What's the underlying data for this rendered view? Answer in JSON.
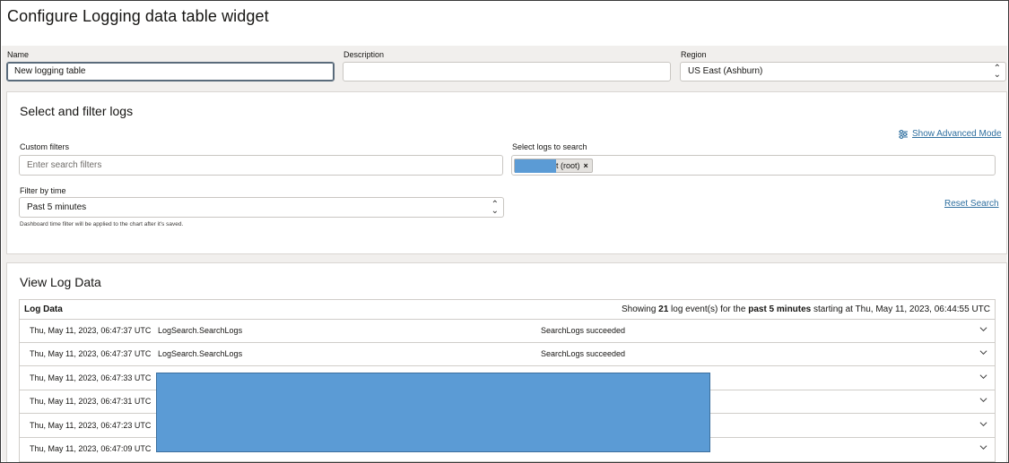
{
  "page": {
    "title": "Configure Logging data table widget"
  },
  "form": {
    "name_label": "Name",
    "name_value": "New logging table",
    "description_label": "Description",
    "description_value": "",
    "region_label": "Region",
    "region_value": "US East (Ashburn)"
  },
  "filter_panel": {
    "title": "Select and filter logs",
    "advanced_mode_link": "Show Advanced Mode",
    "custom_filters_label": "Custom filters",
    "custom_filters_placeholder": "Enter search filters",
    "select_logs_label": "Select logs to search",
    "selected_log_chip": "t (root)",
    "chip_remove": "×",
    "filter_time_label": "Filter by time",
    "filter_time_value": "Past 5 minutes",
    "helper_text": "Dashboard time filter will be applied to the chart after it's saved.",
    "reset_link": "Reset Search"
  },
  "log_panel": {
    "title": "View Log Data",
    "table_title": "Log Data",
    "summary": {
      "prefix": "Showing ",
      "count": "21",
      "middle": " log event(s) for the ",
      "range": "past 5 minutes",
      "suffix": " starting at Thu, May 11, 2023, 06:44:55 UTC"
    },
    "rows": [
      {
        "time": "Thu, May 11, 2023, 06:47:37 UTC",
        "event": "LogSearch.SearchLogs",
        "message": "SearchLogs succeeded"
      },
      {
        "time": "Thu, May 11, 2023, 06:47:37 UTC",
        "event": "LogSearch.SearchLogs",
        "message": "SearchLogs succeeded"
      },
      {
        "time": "Thu, May 11, 2023, 06:47:33 UTC",
        "event": "",
        "message": ""
      },
      {
        "time": "Thu, May 11, 2023, 06:47:31 UTC",
        "event": "",
        "message": ""
      },
      {
        "time": "Thu, May 11, 2023, 06:47:23 UTC",
        "event": "",
        "message": ""
      },
      {
        "time": "Thu, May 11, 2023, 06:47:09 UTC",
        "event": "",
        "message": ""
      }
    ]
  },
  "colors": {
    "link": "#2f6f9f",
    "redaction": "#5b9bd5",
    "band": "#f1efed"
  },
  "icons": {
    "advanced_mode": "sliders-icon",
    "select_arrows": "select-updown-icon",
    "row_expand": "chevron-down-icon"
  }
}
